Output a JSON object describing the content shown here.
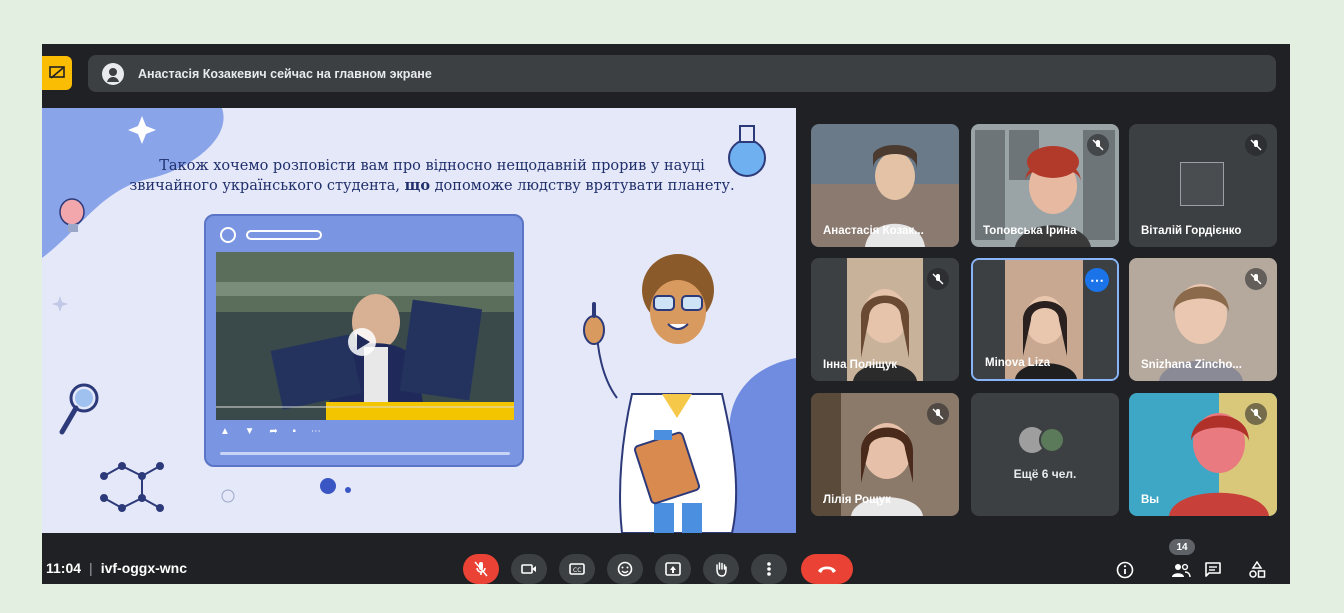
{
  "banner": {
    "text": "Анастасія Козакевич сейчас на главном экране"
  },
  "slide": {
    "line1": "Також хочемо розповісти вам про відносно нещодавній прорив у науці",
    "line2_pre": "звичайного українського студента, ",
    "line2_bold": "що",
    "line2_post": " допоможе людству врятувати планету."
  },
  "participants": [
    {
      "name": "Анастасія Козак..."
    },
    {
      "name": "Топовська Ірина"
    },
    {
      "name": "Віталій Гордієнко"
    },
    {
      "name": "Інна Поліщук"
    },
    {
      "name": "Minova Liza"
    },
    {
      "name": "Snizhana Zincho..."
    },
    {
      "name": "Лілія Рощук"
    },
    {
      "name": "Ещё 6 чел."
    },
    {
      "name": "Вы"
    }
  ],
  "meeting": {
    "time": "11:04",
    "separator": "|",
    "code": "ivf-oggx-wnc"
  },
  "people_count": "14",
  "colors": {
    "hangup": "#ea4335",
    "mic_off": "#ea4335",
    "active_border": "#8ab4f8",
    "present_icon": "#fbbc04"
  }
}
